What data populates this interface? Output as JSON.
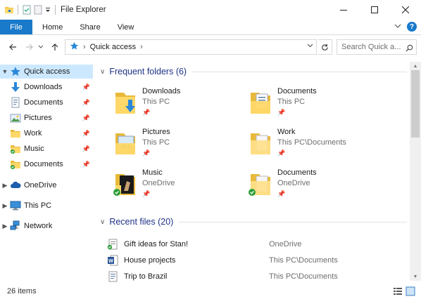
{
  "window": {
    "title": "File Explorer",
    "accent": "#1979ca"
  },
  "ribbon": {
    "tabs": [
      "File",
      "Home",
      "Share",
      "View"
    ]
  },
  "address": {
    "location": "Quick access",
    "search_placeholder": "Search Quick a..."
  },
  "navpane": {
    "quick_access": "Quick access",
    "pinned": [
      {
        "label": "Downloads",
        "icon": "download-icon"
      },
      {
        "label": "Documents",
        "icon": "documents-icon"
      },
      {
        "label": "Pictures",
        "icon": "pictures-icon"
      },
      {
        "label": "Work",
        "icon": "folder-icon"
      },
      {
        "label": "Music",
        "icon": "music-folder-icon"
      },
      {
        "label": "Documents",
        "icon": "documents-folder-icon"
      }
    ],
    "onedrive": "OneDrive",
    "thispc": "This PC",
    "network": "Network"
  },
  "frequent": {
    "header": "Frequent folders (6)",
    "folders": [
      {
        "name": "Downloads",
        "location": "This PC"
      },
      {
        "name": "Documents",
        "location": "This PC"
      },
      {
        "name": "Pictures",
        "location": "This PC"
      },
      {
        "name": "Work",
        "location": "This PC\\Documents"
      },
      {
        "name": "Music",
        "location": "OneDrive"
      },
      {
        "name": "Documents",
        "location": "OneDrive"
      }
    ]
  },
  "recent": {
    "header": "Recent files (20)",
    "files": [
      {
        "name": "Gift ideas for Stan!",
        "location": "OneDrive"
      },
      {
        "name": "House projects",
        "location": "This PC\\Documents"
      },
      {
        "name": "Trip to Brazil",
        "location": "This PC\\Documents"
      }
    ]
  },
  "status": {
    "items": "26 items"
  }
}
